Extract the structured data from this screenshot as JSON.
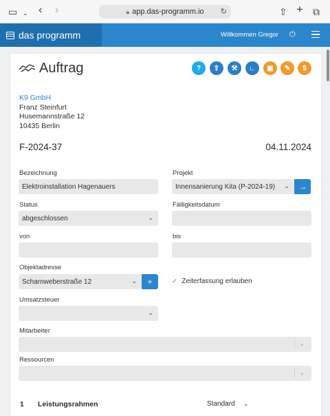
{
  "browser": {
    "url": "app.das-programm.io",
    "icons": [
      "sidebar-icon",
      "chevron-down-icon",
      "back-icon",
      "forward-icon",
      "lock-icon",
      "reload-icon",
      "share-icon",
      "new-tab-icon",
      "tabs-icon"
    ]
  },
  "header": {
    "brand": "das programm",
    "welcome": "Willkommen Gregor"
  },
  "page": {
    "title": "Auftrag",
    "toolbar": [
      {
        "name": "help-button",
        "glyph": "?",
        "color": "#21a9e8"
      },
      {
        "name": "upload-button",
        "glyph": "⇪",
        "color": "#2d7fc4"
      },
      {
        "name": "tools-button",
        "glyph": "⚒",
        "color": "#2d7fc4"
      },
      {
        "name": "measure-button",
        "glyph": "∟",
        "color": "#2d7fc4"
      },
      {
        "name": "save-button",
        "glyph": "▣",
        "color": "#ef9a2d"
      },
      {
        "name": "edit-document-button",
        "glyph": "✎",
        "color": "#ef9a2d"
      },
      {
        "name": "invoice-button",
        "glyph": "$",
        "color": "#ef9a2d"
      }
    ]
  },
  "customer": {
    "company": "K9 GmbH",
    "contact": "Franz Steinfurt",
    "street": "Husemannstraße 12",
    "city": "10435 Berlin"
  },
  "document": {
    "number": "F-2024-37",
    "date": "04.11.2024"
  },
  "form": {
    "bezeichnung": {
      "label": "Bezeichnung",
      "value": "Elektroinstallation Hagenauers"
    },
    "projekt": {
      "label": "Projekt",
      "value": "Innensanierung Kita (P-2024-19)"
    },
    "status": {
      "label": "Status",
      "value": "abgeschlossen"
    },
    "faelligkeit": {
      "label": "Fälligkeitsdatum",
      "value": ""
    },
    "von": {
      "label": "von",
      "value": ""
    },
    "bis": {
      "label": "bis",
      "value": ""
    },
    "objektadresse": {
      "label": "Objektadresse",
      "value": "Scharnweberstraße 12"
    },
    "zeiterfassung": {
      "label": "Zeiterfassung erlauben",
      "checked": true
    },
    "umsatzsteuer": {
      "label": "Umsatzsteuer",
      "value": ""
    },
    "mitarbeiter": {
      "label": "Mitarbeiter",
      "value": ""
    },
    "ressourcen": {
      "label": "Ressourcen",
      "value": ""
    }
  },
  "section": {
    "number": "1",
    "title": "Leistungsrahmen",
    "mode": "Standard"
  }
}
